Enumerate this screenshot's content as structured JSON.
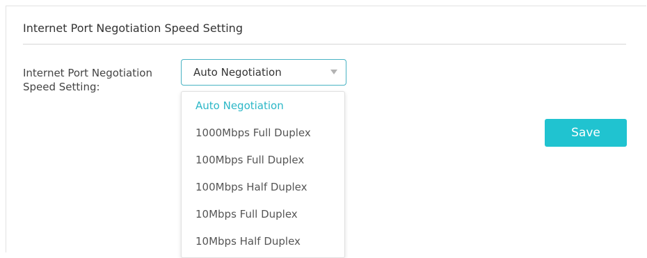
{
  "section": {
    "title": "Internet Port Negotiation Speed Setting"
  },
  "form": {
    "label": "Internet Port Negotiation Speed Setting:",
    "selected_value": "Auto Negotiation",
    "options": [
      "Auto Negotiation",
      "1000Mbps Full Duplex",
      "100Mbps Full Duplex",
      "100Mbps Half Duplex",
      "10Mbps Full Duplex",
      "10Mbps Half Duplex"
    ],
    "selected_index": 0
  },
  "actions": {
    "save_label": "Save"
  },
  "colors": {
    "accent": "#2bb7c7",
    "button_bg": "#20c3d0",
    "select_border": "#47b2c3"
  }
}
